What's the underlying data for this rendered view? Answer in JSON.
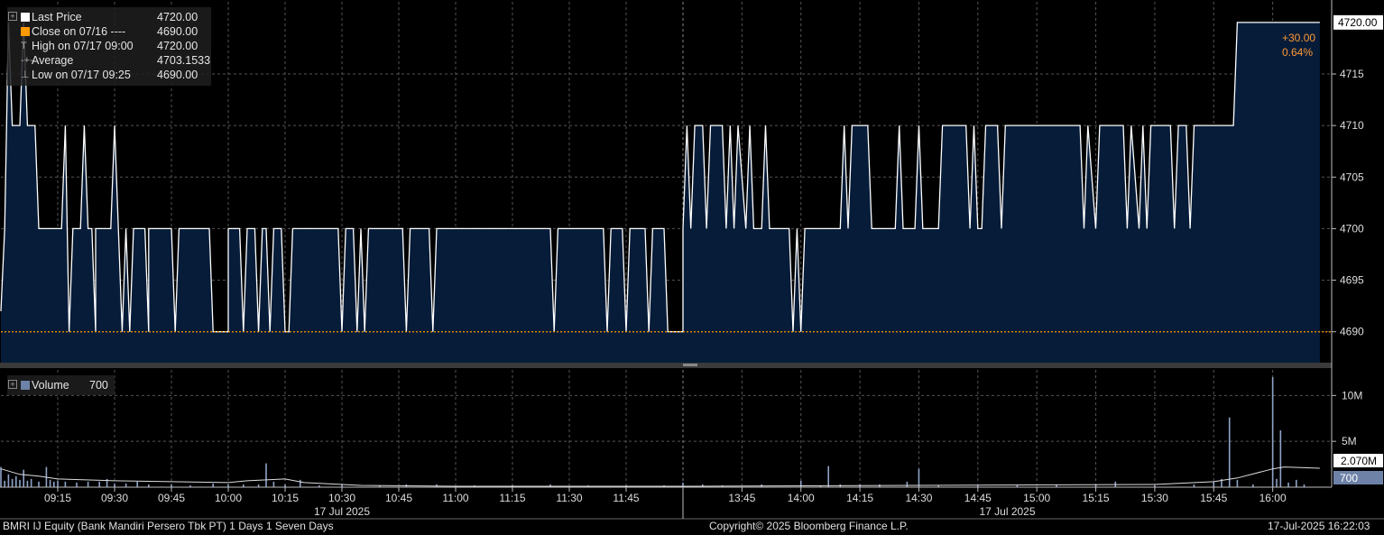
{
  "legend_price": {
    "rows": [
      {
        "label": "Last Price",
        "value": "4720.00",
        "marker": "#ffffff"
      },
      {
        "label": "Close on 07/16 ----",
        "value": "4690.00",
        "marker": "#ff9900"
      },
      {
        "label": "High on 07/17 09:00",
        "value": "4720.00",
        "marker": "high-glyph"
      },
      {
        "label": "Average",
        "value": "4703.1533",
        "marker": "avg-glyph"
      },
      {
        "label": "Low on 07/17 09:25",
        "value": "4690.00",
        "marker": "low-glyph"
      }
    ]
  },
  "legend_volume": {
    "label": "Volume",
    "value": "700",
    "marker": "#6e82a8"
  },
  "change": {
    "abs": "+30.00",
    "pct": "0.64%",
    "color": "#ff9933"
  },
  "footer": {
    "left": "BMRI IJ Equity (Bank Mandiri Persero Tbk PT) 1 Days 1 Seven Days",
    "center": "Copyright© 2025 Bloomberg Finance L.P.",
    "right": "17-Jul-2025 16:22:03"
  },
  "colors": {
    "background": "#000000",
    "fill": "#061c39",
    "line": "#ffffff",
    "prev_close": "#ff9900",
    "volume": "#8fa3c8",
    "grid": "#555555"
  },
  "chart_data": [
    {
      "type": "line",
      "series": [
        {
          "name": "Last Price"
        }
      ],
      "ylim": [
        4687,
        4722
      ],
      "y_ticks": [
        4690,
        4695,
        4700,
        4705,
        4710,
        4715
      ],
      "last_price_label": "4720.00",
      "prev_close": 4690,
      "sessions": [
        {
          "start": "09:00",
          "end": "12:00",
          "date_label": "17 Jul 2025"
        },
        {
          "start": "13:30",
          "end": "16:15",
          "date_label": "17 Jul 2025"
        }
      ],
      "x_ticks": [
        "09:15",
        "09:30",
        "09:45",
        "10:00",
        "10:15",
        "10:30",
        "10:45",
        "11:00",
        "11:15",
        "11:30",
        "11:45",
        "13:45",
        "14:00",
        "14:15",
        "14:30",
        "14:45",
        "15:00",
        "15:15",
        "15:30",
        "15:45",
        "16:00"
      ],
      "points": [
        [
          "09:00",
          4692
        ],
        [
          "09:01",
          4700
        ],
        [
          "09:02",
          4720
        ],
        [
          "09:03",
          4710
        ],
        [
          "09:05",
          4710
        ],
        [
          "09:06",
          4720
        ],
        [
          "09:07",
          4710
        ],
        [
          "09:09",
          4710
        ],
        [
          "09:10",
          4700
        ],
        [
          "09:16",
          4700
        ],
        [
          "09:17",
          4710
        ],
        [
          "09:18",
          4690
        ],
        [
          "09:19",
          4700
        ],
        [
          "09:21",
          4700
        ],
        [
          "09:22",
          4710
        ],
        [
          "09:23",
          4700
        ],
        [
          "09:24",
          4700
        ],
        [
          "09:25",
          4690
        ],
        [
          "09:25",
          4700
        ],
        [
          "09:29",
          4700
        ],
        [
          "09:30",
          4710
        ],
        [
          "09:31",
          4700
        ],
        [
          "09:32",
          4690
        ],
        [
          "09:33",
          4700
        ],
        [
          "09:34",
          4690
        ],
        [
          "09:35",
          4700
        ],
        [
          "09:38",
          4700
        ],
        [
          "09:39",
          4690
        ],
        [
          "09:39",
          4700
        ],
        [
          "09:45",
          4700
        ],
        [
          "09:46",
          4690
        ],
        [
          "09:47",
          4700
        ],
        [
          "09:55",
          4700
        ],
        [
          "09:56",
          4690
        ],
        [
          "10:00",
          4690
        ],
        [
          "10:00",
          4700
        ],
        [
          "10:03",
          4700
        ],
        [
          "10:04",
          4690
        ],
        [
          "10:05",
          4700
        ],
        [
          "10:07",
          4700
        ],
        [
          "10:08",
          4690
        ],
        [
          "10:09",
          4700
        ],
        [
          "10:10",
          4700
        ],
        [
          "10:11",
          4690
        ],
        [
          "10:12",
          4700
        ],
        [
          "10:14",
          4700
        ],
        [
          "10:15",
          4690
        ],
        [
          "10:16",
          4690
        ],
        [
          "10:17",
          4700
        ],
        [
          "10:29",
          4700
        ],
        [
          "10:30",
          4690
        ],
        [
          "10:31",
          4700
        ],
        [
          "10:33",
          4700
        ],
        [
          "10:34",
          4690
        ],
        [
          "10:35",
          4700
        ],
        [
          "10:36",
          4690
        ],
        [
          "10:37",
          4700
        ],
        [
          "10:46",
          4700
        ],
        [
          "10:47",
          4690
        ],
        [
          "10:48",
          4700
        ],
        [
          "10:53",
          4700
        ],
        [
          "10:54",
          4690
        ],
        [
          "10:55",
          4700
        ],
        [
          "11:25",
          4700
        ],
        [
          "11:26",
          4690
        ],
        [
          "11:27",
          4700
        ],
        [
          "11:39",
          4700
        ],
        [
          "11:40",
          4690
        ],
        [
          "11:41",
          4700
        ],
        [
          "11:44",
          4700
        ],
        [
          "11:45",
          4690
        ],
        [
          "11:46",
          4700
        ],
        [
          "11:50",
          4700
        ],
        [
          "11:51",
          4690
        ],
        [
          "11:52",
          4700
        ],
        [
          "11:55",
          4700
        ],
        [
          "11:56",
          4690
        ],
        [
          "13:30",
          4690
        ],
        [
          "13:30",
          4700
        ],
        [
          "13:31",
          4710
        ],
        [
          "13:32",
          4700
        ],
        [
          "13:33",
          4710
        ],
        [
          "13:35",
          4710
        ],
        [
          "13:36",
          4700
        ],
        [
          "13:37",
          4710
        ],
        [
          "13:40",
          4710
        ],
        [
          "13:41",
          4700
        ],
        [
          "13:42",
          4710
        ],
        [
          "13:43",
          4700
        ],
        [
          "13:44",
          4710
        ],
        [
          "13:46",
          4700
        ],
        [
          "13:47",
          4710
        ],
        [
          "13:48",
          4700
        ],
        [
          "13:50",
          4700
        ],
        [
          "13:51",
          4710
        ],
        [
          "13:52",
          4700
        ],
        [
          "13:57",
          4700
        ],
        [
          "13:58",
          4690
        ],
        [
          "13:59",
          4700
        ],
        [
          "14:00",
          4690
        ],
        [
          "14:01",
          4700
        ],
        [
          "14:10",
          4700
        ],
        [
          "14:11",
          4710
        ],
        [
          "14:12",
          4700
        ],
        [
          "14:13",
          4710
        ],
        [
          "14:17",
          4710
        ],
        [
          "14:18",
          4700
        ],
        [
          "14:24",
          4700
        ],
        [
          "14:25",
          4710
        ],
        [
          "14:26",
          4700
        ],
        [
          "14:29",
          4700
        ],
        [
          "14:30",
          4710
        ],
        [
          "14:31",
          4700
        ],
        [
          "14:35",
          4700
        ],
        [
          "14:36",
          4710
        ],
        [
          "14:42",
          4710
        ],
        [
          "14:43",
          4700
        ],
        [
          "14:44",
          4710
        ],
        [
          "14:45",
          4700
        ],
        [
          "14:46",
          4700
        ],
        [
          "14:47",
          4710
        ],
        [
          "14:50",
          4710
        ],
        [
          "14:51",
          4700
        ],
        [
          "14:52",
          4710
        ],
        [
          "15:11",
          4710
        ],
        [
          "15:12",
          4700
        ],
        [
          "15:13",
          4710
        ],
        [
          "15:15",
          4700
        ],
        [
          "15:16",
          4710
        ],
        [
          "15:22",
          4710
        ],
        [
          "15:23",
          4700
        ],
        [
          "15:24",
          4710
        ],
        [
          "15:26",
          4700
        ],
        [
          "15:27",
          4710
        ],
        [
          "15:28",
          4700
        ],
        [
          "15:29",
          4710
        ],
        [
          "15:34",
          4710
        ],
        [
          "15:35",
          4700
        ],
        [
          "15:36",
          4710
        ],
        [
          "15:38",
          4710
        ],
        [
          "15:39",
          4700
        ],
        [
          "15:40",
          4710
        ],
        [
          "15:50",
          4710
        ],
        [
          "15:51",
          4720
        ],
        [
          "16:12",
          4720
        ]
      ]
    },
    {
      "type": "bar",
      "series": [
        {
          "name": "Volume"
        }
      ],
      "ylim": [
        0,
        12000000
      ],
      "y_ticks": [
        {
          "value": 5000000,
          "label": "5M"
        },
        {
          "value": 10000000,
          "label": "10M"
        }
      ],
      "last_volume_label": "700",
      "average_label": "2.070M",
      "bars": [
        [
          "09:00",
          2200000
        ],
        [
          "09:01",
          700000
        ],
        [
          "09:02",
          1400000
        ],
        [
          "09:03",
          900000
        ],
        [
          "09:04",
          1200000
        ],
        [
          "09:05",
          800000
        ],
        [
          "09:06",
          1900000
        ],
        [
          "09:07",
          700000
        ],
        [
          "09:08",
          900000
        ],
        [
          "09:10",
          600000
        ],
        [
          "09:12",
          2200000
        ],
        [
          "09:13",
          800000
        ],
        [
          "09:14",
          600000
        ],
        [
          "09:15",
          700000
        ],
        [
          "09:17",
          600000
        ],
        [
          "09:20",
          500000
        ],
        [
          "09:23",
          600000
        ],
        [
          "09:26",
          600000
        ],
        [
          "09:28",
          900000
        ],
        [
          "09:30",
          400000
        ],
        [
          "09:33",
          400000
        ],
        [
          "09:36",
          600000
        ],
        [
          "09:39",
          300000
        ],
        [
          "09:45",
          300000
        ],
        [
          "09:50",
          200000
        ],
        [
          "09:56",
          400000
        ],
        [
          "10:00",
          300000
        ],
        [
          "10:04",
          300000
        ],
        [
          "10:08",
          300000
        ],
        [
          "10:10",
          2600000
        ],
        [
          "10:12",
          600000
        ],
        [
          "10:15",
          300000
        ],
        [
          "10:19",
          800000
        ],
        [
          "10:24",
          200000
        ],
        [
          "10:30",
          300000
        ],
        [
          "10:40",
          200000
        ],
        [
          "10:47",
          300000
        ],
        [
          "10:55",
          300000
        ],
        [
          "11:05",
          200000
        ],
        [
          "11:15",
          200000
        ],
        [
          "11:25",
          300000
        ],
        [
          "11:35",
          200000
        ],
        [
          "11:45",
          200000
        ],
        [
          "11:55",
          200000
        ],
        [
          "13:30",
          500000
        ],
        [
          "13:35",
          300000
        ],
        [
          "13:40",
          200000
        ],
        [
          "13:50",
          300000
        ],
        [
          "14:00",
          700000
        ],
        [
          "14:05",
          200000
        ],
        [
          "14:07",
          2300000
        ],
        [
          "14:10",
          300000
        ],
        [
          "14:15",
          300000
        ],
        [
          "14:20",
          300000
        ],
        [
          "14:27",
          600000
        ],
        [
          "14:30",
          2000000
        ],
        [
          "14:35",
          200000
        ],
        [
          "14:45",
          200000
        ],
        [
          "14:55",
          200000
        ],
        [
          "15:05",
          300000
        ],
        [
          "15:15",
          300000
        ],
        [
          "15:20",
          600000
        ],
        [
          "15:30",
          200000
        ],
        [
          "15:40",
          300000
        ],
        [
          "15:45",
          600000
        ],
        [
          "15:47",
          900000
        ],
        [
          "15:49",
          7600000
        ],
        [
          "15:51",
          800000
        ],
        [
          "15:55",
          300000
        ],
        [
          "16:00",
          12000000
        ],
        [
          "16:01",
          900000
        ],
        [
          "16:02",
          6200000
        ],
        [
          "16:04",
          500000
        ],
        [
          "16:06",
          800000
        ],
        [
          "16:08",
          300000
        ]
      ],
      "average_line": [
        [
          "09:00",
          2000000
        ],
        [
          "09:05",
          1400000
        ],
        [
          "09:10",
          1200000
        ],
        [
          "09:15",
          900000
        ],
        [
          "09:30",
          700000
        ],
        [
          "09:45",
          600000
        ],
        [
          "10:00",
          500000
        ],
        [
          "10:05",
          700000
        ],
        [
          "10:15",
          900000
        ],
        [
          "10:20",
          500000
        ],
        [
          "10:35",
          200000
        ],
        [
          "11:00",
          100000
        ],
        [
          "11:55",
          100000
        ],
        [
          "13:30",
          100000
        ],
        [
          "14:30",
          200000
        ],
        [
          "15:30",
          300000
        ],
        [
          "15:45",
          600000
        ],
        [
          "15:51",
          1000000
        ],
        [
          "16:00",
          2000000
        ],
        [
          "16:03",
          2200000
        ],
        [
          "16:12",
          2070000
        ]
      ]
    }
  ]
}
